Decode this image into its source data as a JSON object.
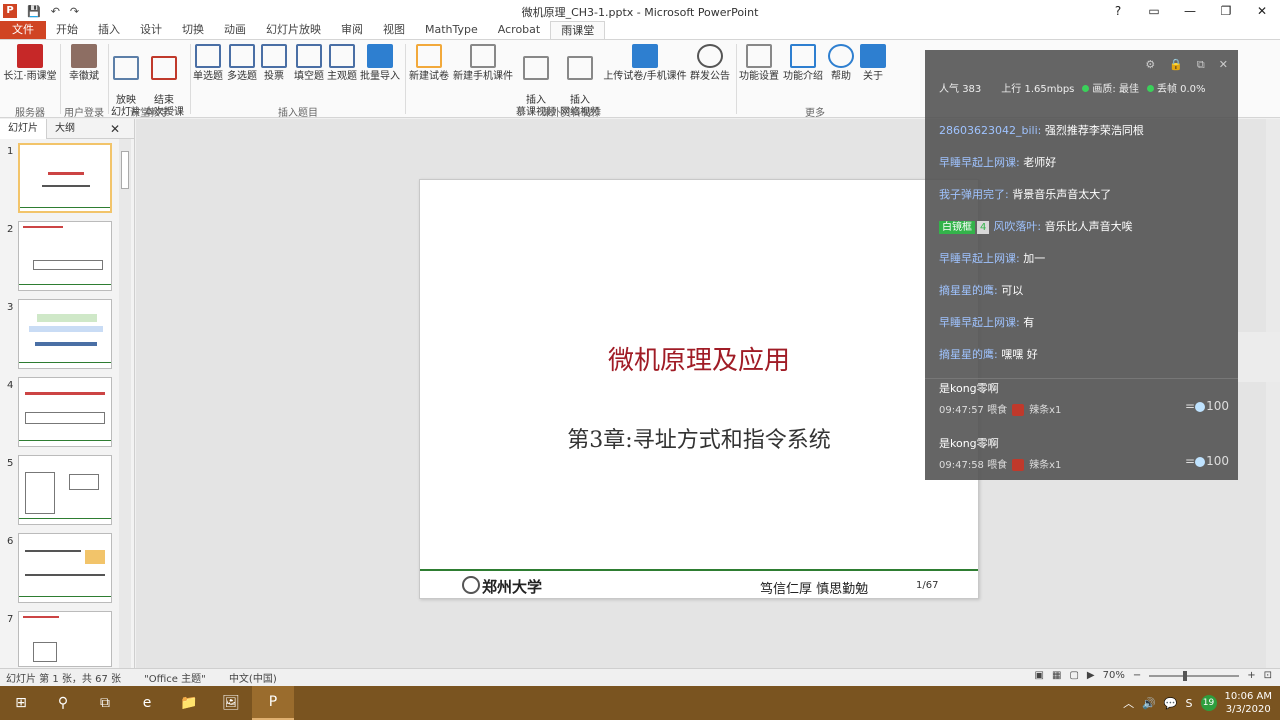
{
  "window": {
    "title": "微机原理_CH3-1.pptx - Microsoft PowerPoint",
    "app_letter": "P",
    "controls": [
      "?",
      "▭",
      "—",
      "❐",
      "✕"
    ]
  },
  "quick_access": [
    "💾",
    "↶",
    "↷"
  ],
  "tabs": [
    "文件",
    "开始",
    "插入",
    "设计",
    "切换",
    "动画",
    "幻灯片放映",
    "审阅",
    "视图",
    "MathType",
    "Acrobat",
    "雨课堂"
  ],
  "ribbon": {
    "buttons": [
      {
        "label": "长江·雨课堂",
        "color": "#c62828"
      },
      {
        "label": "幸徽斌",
        "color": "#8d6e63"
      },
      {
        "label": "放映\n幻灯片",
        "color": "#5c7fa8"
      },
      {
        "label": "结束\n本次授课",
        "color": "#c0392b"
      },
      {
        "label": "单选题",
        "color": "#4a6fa5"
      },
      {
        "label": "多选题",
        "color": "#4a6fa5"
      },
      {
        "label": "投票",
        "color": "#4a6fa5"
      },
      {
        "label": "填空题",
        "color": "#4a6fa5"
      },
      {
        "label": "主观题",
        "color": "#4a6fa5"
      },
      {
        "label": "批量导入",
        "color": "#2e7fd0"
      },
      {
        "label": "新建试卷",
        "color": "#f2a93b"
      },
      {
        "label": "新建手机课件",
        "color": "#888888"
      },
      {
        "label": "插入\n慕课视频",
        "color": "#888888"
      },
      {
        "label": "插入\n网络视频",
        "color": "#888888"
      },
      {
        "label": "上传试卷/手机课件",
        "color": "#2e7fd0"
      },
      {
        "label": "群发公告",
        "color": "#555555"
      },
      {
        "label": "功能设置",
        "color": "#888888"
      },
      {
        "label": "功能介绍",
        "color": "#2e7fd0"
      },
      {
        "label": "帮助",
        "color": "#2e7fd0"
      },
      {
        "label": "关于",
        "color": "#2e7fd0"
      }
    ],
    "groups": [
      "服务器",
      "用户登录",
      "课堂教学",
      "插入题目",
      "课外资料制作",
      "更多"
    ]
  },
  "left_panel": {
    "tabs": [
      "幻灯片",
      "大纲"
    ],
    "close": "✕",
    "slide_numbers": [
      "1",
      "2",
      "3",
      "4",
      "5",
      "6",
      "7"
    ]
  },
  "slide": {
    "title": "微机原理及应用",
    "subtitle": "第3章:寻址方式和指令系统",
    "university": "郑州大学",
    "motto": "笃信仁厚  慎思勤勉",
    "page": "1/67"
  },
  "overlay": {
    "icons": [
      "⚙",
      "🔒",
      "⧉",
      "✕"
    ],
    "stats": {
      "popularity_label": "人气",
      "popularity": "383",
      "upload_label": "上行",
      "upload": "1.65mbps",
      "quality_label": "画质:",
      "quality": "最佳",
      "drop_label": "丢帧",
      "drop": "0.0%"
    },
    "messages": [
      {
        "user": "28603623042_bili:",
        "text": "强烈推荐李荣浩同根"
      },
      {
        "user": "早睡早起上网课:",
        "text": "老师好"
      },
      {
        "user": "我子弹用完了:",
        "text": "背景音乐声音太大了"
      },
      {
        "badge": "白镜框",
        "badge_level": "4",
        "user": "风吹落叶:",
        "text": "音乐比人声音大唉"
      },
      {
        "user": "早睡早起上网课:",
        "text": "加一"
      },
      {
        "user": "摘星星的鹰:",
        "text": "可以"
      },
      {
        "user": "早睡早起上网课:",
        "text": "有"
      },
      {
        "user": "摘星星的鹰:",
        "text": "嘿嘿  好"
      }
    ],
    "gifts": [
      {
        "name": "是kong零啊",
        "time": "09:47:57",
        "action": "喂食",
        "item": "辣条x1",
        "amount": "100"
      },
      {
        "name": "是kong零啊",
        "time": "09:47:58",
        "action": "喂食",
        "item": "辣条x1",
        "amount": "100"
      }
    ]
  },
  "statusbar": {
    "slide_info": "幻灯片 第 1 张，共 67 张",
    "theme": "\"Office 主题\"",
    "language": "中文(中国)",
    "zoom": "70%"
  },
  "taskbar": {
    "time": "10:06 AM",
    "date": "3/3/2020",
    "tray_badge": "19",
    "buttons": [
      "⊞",
      "⚲",
      "⧉",
      "e",
      "📁",
      "🖼",
      "P"
    ],
    "tray_icons": [
      "︿",
      "🔊",
      "💬",
      "S"
    ]
  }
}
